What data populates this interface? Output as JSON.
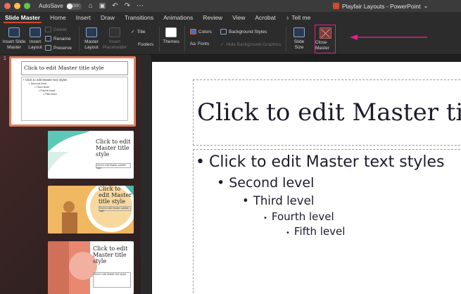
{
  "titlebar": {
    "autosave_label": "AutoSave",
    "toggle_state": "OFF",
    "doc_title": "Playfair Layouts - PowerPoint",
    "colors": {
      "close": "#ed6a5e",
      "minimize": "#f5bf4f",
      "maximize": "#61c554"
    }
  },
  "tabs": [
    "Slide Master",
    "Home",
    "Insert",
    "Draw",
    "Transitions",
    "Animations",
    "Review",
    "View",
    "Acrobat",
    "Tell me"
  ],
  "ribbon": {
    "insert_slide_master": "Insert Slide Master",
    "insert_layout": "Insert Layout",
    "delete": "Delete",
    "rename": "Rename",
    "preserve": "Preserve",
    "master_layout": "Master Layout",
    "insert_placeholder": "Insert Placeholder",
    "title": "Title",
    "footers": "Footers",
    "themes": "Themes",
    "colors": "Colors",
    "fonts": "Fonts",
    "background_styles": "Background Styles",
    "hide_background_graphics": "Hide Background Graphics",
    "slide_size": "Slide Size",
    "close_master": "Close Master",
    "highlight_color": "#e0208a"
  },
  "thumbnails": {
    "slide_number": "1",
    "master": {
      "title": "Click to edit Master title style",
      "levels": [
        "Click to edit Master text styles",
        "Second level",
        "Third level",
        "Fourth level",
        "Fifth level"
      ]
    },
    "layout_title": "Click to edit Master title style",
    "layout_sub": "Click to edit Master subtitle style"
  },
  "slide": {
    "title": "Click to edit Master title style",
    "levels": [
      "Click to edit Master text styles",
      "Second level",
      "Third level",
      "Fourth level",
      "Fifth level"
    ]
  }
}
